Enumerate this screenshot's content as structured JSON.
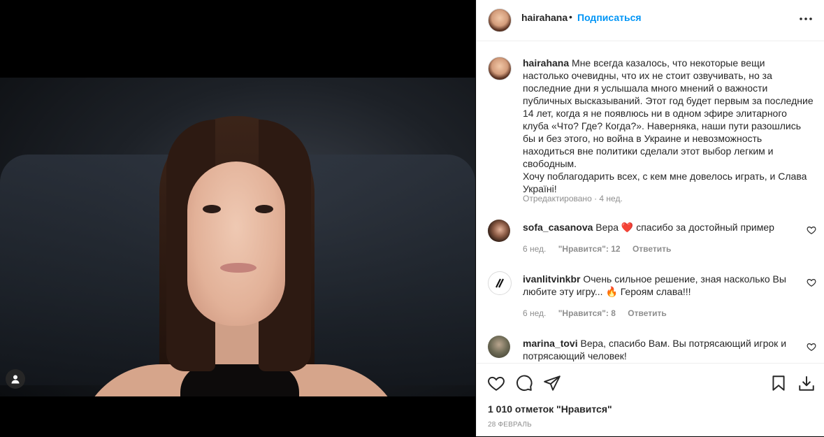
{
  "post": {
    "author": "hairahana",
    "follow_label": "Подписаться",
    "separator": "•",
    "caption": {
      "username": "hairahana",
      "text": "Мне всегда казалось, что некоторые вещи настолько очевидны, что их не стоит озвучивать, но за последние дни я услышала много мнений о важности публичных высказываний. Этот год будет первым за последние 14 лет, когда я не появлюсь ни в одном эфире элитарного клуба «Что? Где? Когда?». Наверняка, наши пути разошлись бы и без этого, но война в Украине и невозможность находиться вне политики сделали этот выбор легким и свободным.",
      "text2": "Хочу поблагодарить всех, с кем мне довелось играть, и Слава Україні!",
      "meta": "Отредактировано · 4 нед."
    },
    "comments": [
      {
        "username": "sofa_casanova",
        "text_before": "Вера",
        "emoji": "❤️",
        "text_after": "спасибо за достойный пример",
        "time": "6 нед.",
        "likes": "\"Нравится\": 12",
        "reply": "Ответить"
      },
      {
        "username": "ivanlitvinkbr",
        "text_before": "Очень сильное решение, зная насколько Вы любите эту игру...",
        "emoji": "🔥",
        "text_after": "Героям слава!!!",
        "time": "6 нед.",
        "likes": "\"Нравится\": 8",
        "reply": "Ответить"
      },
      {
        "username": "marina_tovi",
        "text_before": "Вера, спасибо Вам. Вы потрясающий игрок и потрясающий человек!",
        "emoji": "",
        "text_after": ""
      }
    ],
    "likes_text": "1 010 отметок \"Нравится\"",
    "date": "28 ФЕВРАЛЬ"
  },
  "icons": {
    "more": "more-horizontal-icon",
    "like": "heart-icon",
    "comment": "comment-icon",
    "share": "share-icon",
    "save": "bookmark-icon",
    "download": "download-icon",
    "tagged_user": "user-tag-icon"
  },
  "colors": {
    "link": "#0095f6",
    "text": "#262626",
    "muted": "#8e8e8e",
    "border": "#efefef"
  }
}
